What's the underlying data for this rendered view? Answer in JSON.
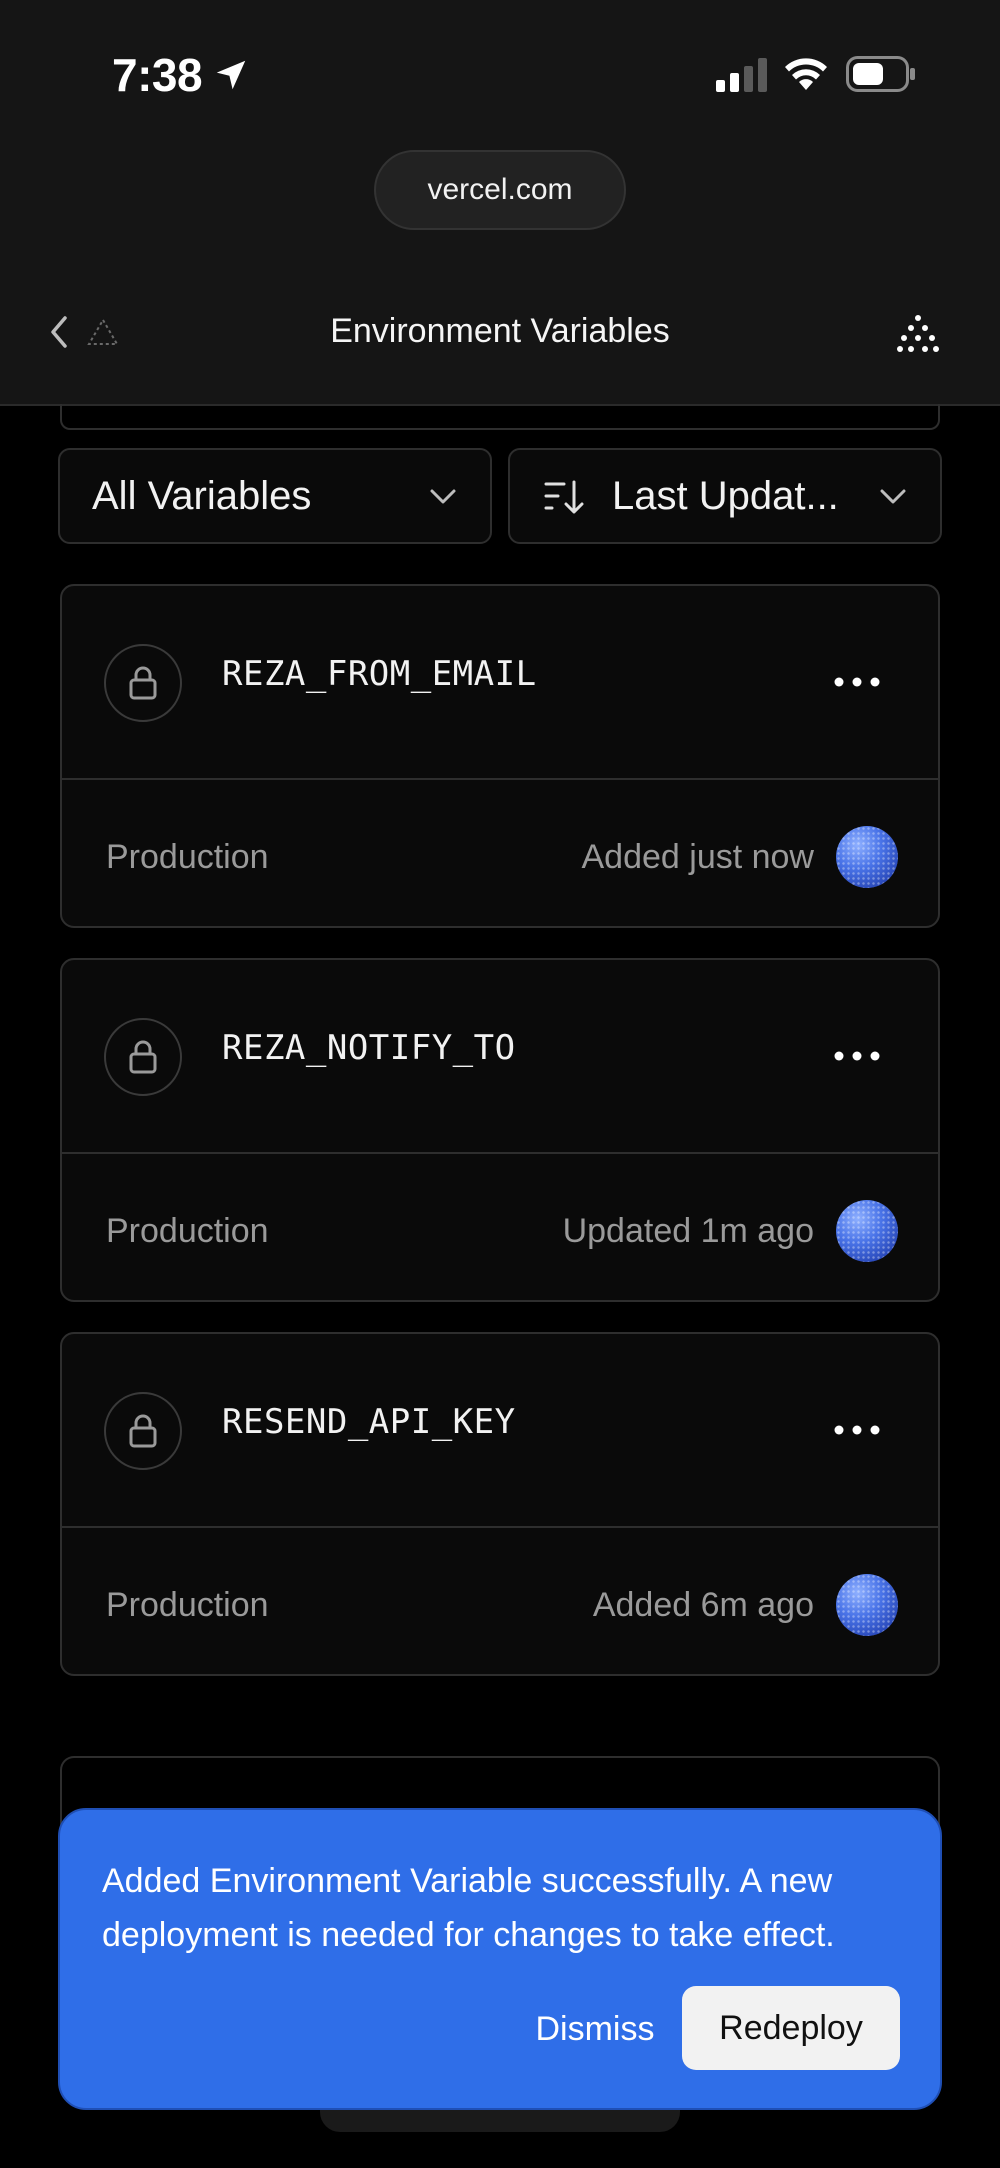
{
  "status_bar": {
    "time": "7:38"
  },
  "browser": {
    "url": "vercel.com"
  },
  "header": {
    "title": "Environment Variables"
  },
  "filters": {
    "scope": "All Variables",
    "sort": "Last Updat..."
  },
  "variables": [
    {
      "name": "REZA_FROM_EMAIL",
      "environment": "Production",
      "time": "Added just now"
    },
    {
      "name": "REZA_NOTIFY_TO",
      "environment": "Production",
      "time": "Updated 1m ago"
    },
    {
      "name": "RESEND_API_KEY",
      "environment": "Production",
      "time": "Added 6m ago"
    }
  ],
  "toast": {
    "message": "Added Environment Variable successfully. A new deployment is needed for changes to take effect.",
    "dismiss_label": "Dismiss",
    "redeploy_label": "Redeploy"
  },
  "colors": {
    "accent": "#2f6ee8",
    "background": "#000000",
    "card_border": "#2e2e2e"
  }
}
